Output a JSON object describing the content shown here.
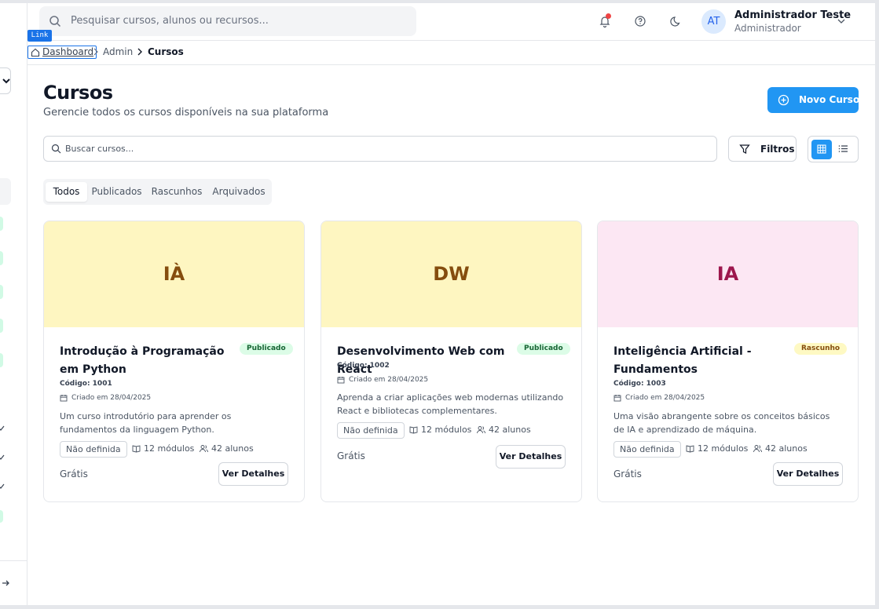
{
  "header": {
    "search_placeholder": "Pesquisar cursos, alunos ou recursos...",
    "user": {
      "initials": "AT",
      "name": "Administrador Teste",
      "role": "Administrador"
    }
  },
  "link_tooltip": "Link",
  "breadcrumb": {
    "home": "Dashboard",
    "section": "Admin",
    "current": "Cursos"
  },
  "page": {
    "title": "Cursos",
    "subtitle": "Gerencie todos os cursos disponíveis na sua plataforma",
    "new_button": "Novo Curso",
    "search_placeholder": "Buscar cursos...",
    "filters_button": "Filtros"
  },
  "tabs": [
    "Todos",
    "Publicados",
    "Rascunhos",
    "Arquivados"
  ],
  "colors": {
    "primary": "#2196f3",
    "published_bg": "#dcfce7",
    "published_fg": "#166534",
    "draft_bg": "#fef9c3",
    "draft_fg": "#854d0e"
  },
  "courses": [
    {
      "initials": "IÀ",
      "cover_color": "#fef6c1",
      "initials_color": "#854d0e",
      "title": "Introdução à Programação em Python",
      "status": "Publicado",
      "code": "Código: 1001",
      "created": "Criado em 28/04/2025",
      "description": "Um curso introdutório para aprender os fundamentos da linguagem Python.",
      "level": "Não definida",
      "modules": "12 módulos",
      "students": "42 alunos",
      "price": "Grátis",
      "details_button": "Ver Detalhes"
    },
    {
      "initials": "DW",
      "cover_color": "#fef6c1",
      "initials_color": "#854d0e",
      "title": "Desenvolvimento Web com React",
      "status": "Publicado",
      "code": "Código: 1002",
      "created": "Criado em 28/04/2025",
      "description": "Aprenda a criar aplicações web modernas utilizando React e bibliotecas complementares.",
      "level": "Não definida",
      "modules": "12 módulos",
      "students": "42 alunos",
      "price": "Grátis",
      "details_button": "Ver Detalhes"
    },
    {
      "initials": "IA",
      "cover_color": "#fce7f3",
      "initials_color": "#9d174d",
      "title": "Inteligência Artificial - Fundamentos",
      "status": "Rascunho",
      "code": "Código: 1003",
      "created": "Criado em 28/04/2025",
      "description": "Uma visão abrangente sobre os conceitos básicos de IA e aprendizado de máquina.",
      "level": "Não definida",
      "modules": "12 módulos",
      "students": "42 alunos",
      "price": "Grátis",
      "details_button": "Ver Detalhes"
    }
  ]
}
